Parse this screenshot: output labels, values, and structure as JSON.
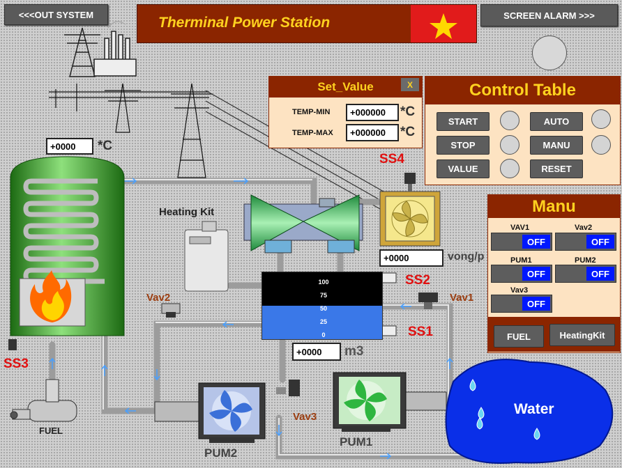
{
  "nav": {
    "out_system": "<<<OUT SYSTEM",
    "screen_alarm": "SCREEN ALARM >>>"
  },
  "title": "Therminal Power Station",
  "set_value": {
    "title": "Set_Value",
    "close": "X",
    "temp_min_label": "TEMP-MIN",
    "temp_min_value": "+000000",
    "temp_max_label": "TEMP-MAX",
    "temp_max_value": "+000000",
    "unit": "*C"
  },
  "control_table": {
    "title": "Control Table",
    "start": "START",
    "stop": "STOP",
    "value": "VALUE",
    "auto": "AUTO",
    "manu": "MANU",
    "reset": "RESET"
  },
  "manu": {
    "title": "Manu",
    "vav1": "VAV1",
    "vav2": "Vav2",
    "pum1": "PUM1",
    "pum2": "PUM2",
    "vav3": "Vav3",
    "off": "OFF",
    "fuel_btn": "FUEL",
    "heating_btn": "HeatingKit"
  },
  "tank_temp": {
    "value": "+0000",
    "unit": "*C"
  },
  "fan_speed": {
    "value": "+0000",
    "unit": "vong/p"
  },
  "water_level": {
    "value": "+0000",
    "unit": "m3",
    "scale": [
      "100",
      "75",
      "50",
      "25",
      "0"
    ],
    "fill_percent": 50
  },
  "labels": {
    "ss1": "SS1",
    "ss2": "SS2",
    "ss3": "SS3",
    "ss4": "SS4",
    "vav1": "Vav1",
    "vav2": "Vav2",
    "vav3": "Vav3",
    "heating_kit": "Heating Kit",
    "fuel": "FUEL",
    "pum1": "PUM1",
    "pum2": "PUM2",
    "water": "Water"
  },
  "colors": {
    "brand": "#8b2500",
    "accent_yellow": "#ffd21f",
    "alarm_red": "#e01010",
    "water_blue": "#0033e0",
    "tank_green": "#2f9a1f"
  }
}
